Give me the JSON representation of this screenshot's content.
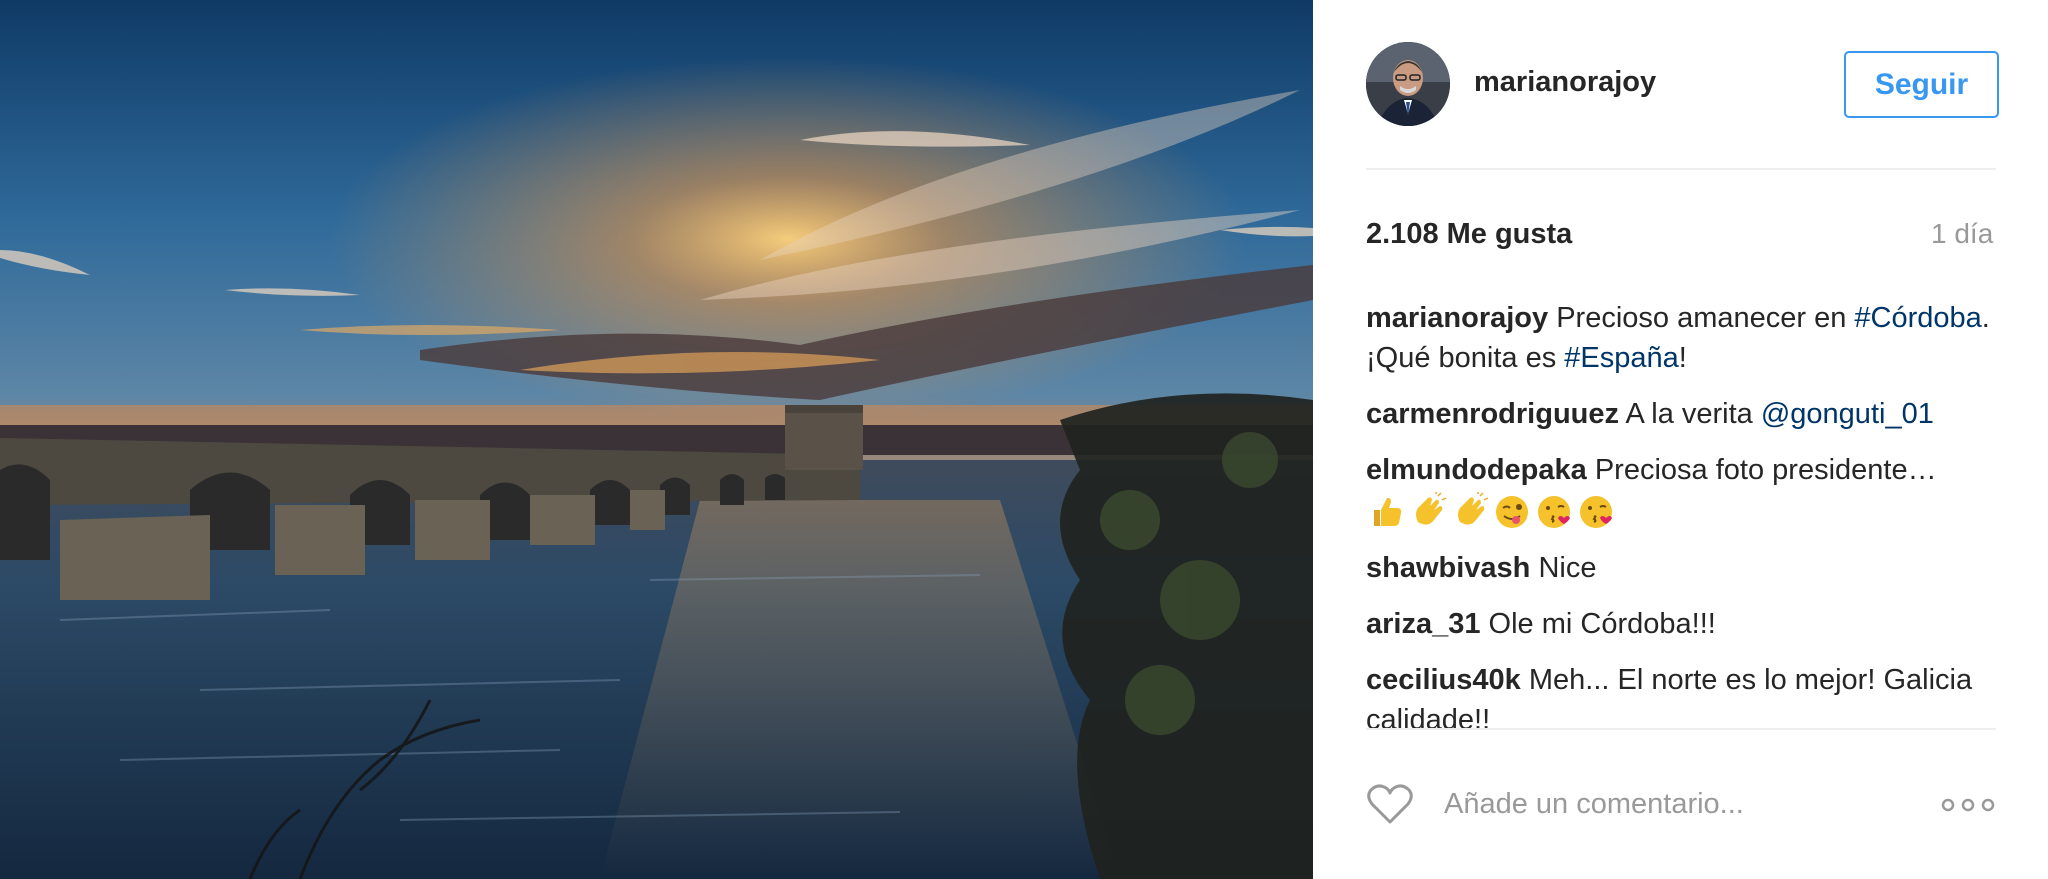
{
  "post": {
    "username": "marianorajoy",
    "follow_label": "Seguir",
    "likes": "2.108 Me gusta",
    "time": "1 día",
    "avatar_icon": "user-avatar",
    "photo_icon": "sunset-bridge-photo"
  },
  "caption": {
    "user": "marianorajoy",
    "text_start": " Precioso amanecer en ",
    "hashtag_1": "#Córdoba",
    "text_middle": ". ¡Qué bonita es ",
    "hashtag_2": "#España",
    "text_end": "!"
  },
  "comments": [
    {
      "user": "carmenrodriguuez",
      "text": " A la verita ",
      "mention": "@gonguti_01"
    },
    {
      "user": "elmundodepaka",
      "text": " Preciosa foto presidente…",
      "emojis": [
        "thumbs-up-icon",
        "clapping-hand-icon",
        "clapping-hand-icon",
        "winking-tongue-face-icon",
        "kissing-face-icon",
        "kissing-face-icon"
      ]
    },
    {
      "user": "shawbivash",
      "text": " Nice"
    },
    {
      "user": "ariza_31",
      "text": " Ole mi Córdoba!!!"
    },
    {
      "user": "cecilius40k",
      "text": " Meh... El norte es lo mejor! Galicia calidade!!"
    }
  ],
  "footer": {
    "placeholder": "Añade un comentario...",
    "like_icon": "heart-icon",
    "more_icon": "more-options-icon"
  },
  "colors": {
    "accent": "#3897f0",
    "link": "#003569",
    "muted": "#999999",
    "text": "#262626",
    "divider": "#efefef"
  }
}
